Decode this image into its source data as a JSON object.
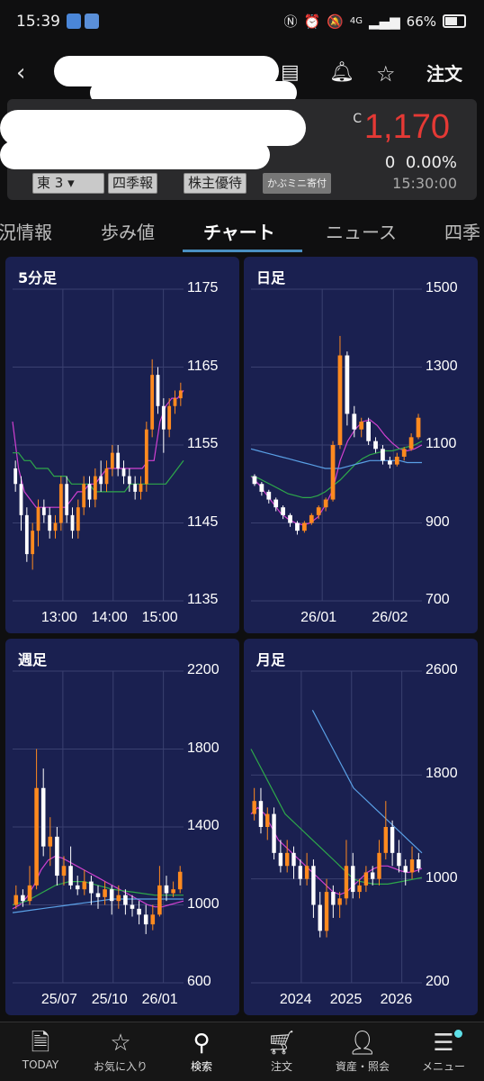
{
  "status_bar": {
    "time": "15:39",
    "battery": "66%",
    "network": "4G"
  },
  "header": {
    "order_label": "注文"
  },
  "quote": {
    "price_mark": "C",
    "price": "1,170",
    "change": "0",
    "change_pct": "0.00%",
    "time": "15:30:00",
    "market": "東 3",
    "chips": [
      "四季報",
      "株主優待",
      "かぶミニ寄付"
    ]
  },
  "tabs": [
    "況情報",
    "歩み値",
    "チャート",
    "ニュース",
    "四季"
  ],
  "active_tab": "チャート",
  "colors": {
    "up": "#ff8a1f",
    "down": "#ffffff",
    "panel_bg": "#1a2050",
    "accent": "#4a90c2",
    "price_red": "#e53935"
  },
  "chart_data": [
    {
      "type": "candlestick",
      "title": "5分足",
      "y_ticks": [
        "1175",
        "1165",
        "1155",
        "1145",
        "1135"
      ],
      "ylim": [
        1135,
        1175
      ],
      "x_ticks": [
        "13:00",
        "14:00",
        "15:00"
      ],
      "series": [
        {
          "color": "#d040d0",
          "values": [
            1158,
            1152,
            1149,
            1148,
            1147,
            1147,
            1147,
            1147,
            1147,
            1147,
            1148,
            1149,
            1149,
            1150,
            1150,
            1151,
            1152,
            1152,
            1152,
            1152,
            1152,
            1152,
            1152,
            1153,
            1153,
            1158,
            1160,
            1161,
            1161,
            1162
          ]
        },
        {
          "color": "#2ea84a",
          "values": [
            1154,
            1154,
            1153,
            1153,
            1152,
            1152,
            1152,
            1151,
            1151,
            1151,
            1150,
            1150,
            1150,
            1150,
            1149,
            1149,
            1149,
            1149,
            1149,
            1149,
            1150,
            1150,
            1150,
            1150,
            1150,
            1150,
            1150,
            1151,
            1152,
            1153
          ]
        }
      ],
      "candles": [
        [
          1152,
          1150,
          1153,
          1149
        ],
        [
          1150,
          1146,
          1151,
          1144
        ],
        [
          1146,
          1141,
          1147,
          1140
        ],
        [
          1141,
          1144,
          1145,
          1139
        ],
        [
          1144,
          1147,
          1148,
          1142
        ],
        [
          1147,
          1146,
          1148,
          1145
        ],
        [
          1146,
          1144,
          1147,
          1143
        ],
        [
          1144,
          1145,
          1146,
          1143
        ],
        [
          1145,
          1150,
          1151,
          1144
        ],
        [
          1150,
          1146,
          1151,
          1145
        ],
        [
          1146,
          1144,
          1147,
          1143
        ],
        [
          1144,
          1147,
          1148,
          1143
        ],
        [
          1147,
          1150,
          1151,
          1146
        ],
        [
          1150,
          1148,
          1151,
          1147
        ],
        [
          1148,
          1151,
          1152,
          1147
        ],
        [
          1151,
          1150,
          1153,
          1149
        ],
        [
          1150,
          1152,
          1153,
          1149
        ],
        [
          1152,
          1154,
          1155,
          1151
        ],
        [
          1154,
          1152,
          1155,
          1151
        ],
        [
          1152,
          1151,
          1153,
          1150
        ],
        [
          1151,
          1150,
          1152,
          1149
        ],
        [
          1150,
          1149,
          1151,
          1148
        ],
        [
          1149,
          1150,
          1151,
          1148
        ],
        [
          1150,
          1157,
          1158,
          1149
        ],
        [
          1157,
          1164,
          1166,
          1156
        ],
        [
          1164,
          1160,
          1165,
          1159
        ],
        [
          1160,
          1157,
          1161,
          1154
        ],
        [
          1157,
          1160,
          1161,
          1156
        ],
        [
          1160,
          1161,
          1162,
          1159
        ],
        [
          1161,
          1162,
          1163,
          1160
        ]
      ]
    },
    {
      "type": "candlestick",
      "title": "日足",
      "y_ticks": [
        "1500",
        "1300",
        "1100",
        "900",
        "700"
      ],
      "ylim": [
        700,
        1500
      ],
      "x_ticks": [
        "26/01",
        "26/02"
      ],
      "series": [
        {
          "color": "#d040d0",
          "values": [
            1020,
            1000,
            975,
            950,
            925,
            910,
            900,
            895,
            900,
            915,
            945,
            985,
            1060,
            1110,
            1140,
            1160,
            1165,
            1150,
            1125,
            1105,
            1090,
            1085,
            1090,
            1100
          ]
        },
        {
          "color": "#2ea84a",
          "values": [
            1020,
            1015,
            1005,
            995,
            985,
            975,
            970,
            965,
            965,
            970,
            980,
            995,
            1010,
            1030,
            1050,
            1065,
            1075,
            1080,
            1085,
            1085,
            1090,
            1095,
            1100,
            1110
          ]
        },
        {
          "color": "#5aa0e6",
          "values": [
            1090,
            1085,
            1080,
            1075,
            1070,
            1065,
            1060,
            1055,
            1050,
            1045,
            1040,
            1040,
            1040,
            1045,
            1050,
            1055,
            1060,
            1060,
            1060,
            1060,
            1060,
            1055,
            1055,
            1055
          ]
        }
      ],
      "candles": [
        [
          1020,
          1000,
          1025,
          995
        ],
        [
          1000,
          980,
          1005,
          970
        ],
        [
          980,
          960,
          985,
          950
        ],
        [
          960,
          940,
          965,
          930
        ],
        [
          940,
          920,
          945,
          910
        ],
        [
          920,
          900,
          925,
          890
        ],
        [
          900,
          880,
          905,
          870
        ],
        [
          880,
          900,
          905,
          875
        ],
        [
          900,
          920,
          925,
          895
        ],
        [
          920,
          940,
          945,
          910
        ],
        [
          940,
          960,
          965,
          930
        ],
        [
          960,
          1100,
          1110,
          955
        ],
        [
          1100,
          1330,
          1380,
          1090
        ],
        [
          1330,
          1180,
          1340,
          1150
        ],
        [
          1180,
          1140,
          1200,
          1120
        ],
        [
          1140,
          1160,
          1170,
          1120
        ],
        [
          1160,
          1110,
          1170,
          1100
        ],
        [
          1110,
          1090,
          1120,
          1080
        ],
        [
          1090,
          1060,
          1100,
          1050
        ],
        [
          1060,
          1050,
          1070,
          1040
        ],
        [
          1050,
          1070,
          1080,
          1045
        ],
        [
          1070,
          1090,
          1095,
          1060
        ],
        [
          1090,
          1120,
          1130,
          1085
        ],
        [
          1120,
          1170,
          1180,
          1115
        ]
      ]
    },
    {
      "type": "candlestick",
      "title": "週足",
      "y_ticks": [
        "2200",
        "1800",
        "1400",
        "1000",
        "600"
      ],
      "ylim": [
        600,
        2200
      ],
      "x_ticks": [
        "25/07",
        "25/10",
        "26/01"
      ],
      "series": [
        {
          "color": "#d040d0",
          "values": [
            980,
            1000,
            1040,
            1100,
            1180,
            1230,
            1250,
            1240,
            1220,
            1200,
            1180,
            1160,
            1140,
            1120,
            1100,
            1080,
            1060,
            1040,
            1020,
            1000,
            990,
            990,
            1000,
            1010,
            1020
          ]
        },
        {
          "color": "#2ea84a",
          "values": [
            1000,
            1010,
            1020,
            1040,
            1060,
            1080,
            1100,
            1110,
            1120,
            1120,
            1120,
            1110,
            1100,
            1090,
            1080,
            1075,
            1070,
            1065,
            1060,
            1055,
            1050,
            1050,
            1050,
            1050,
            1050
          ]
        },
        {
          "color": "#5aa0e6",
          "values": [
            960,
            965,
            970,
            975,
            980,
            985,
            990,
            995,
            1000,
            1005,
            1010,
            1015,
            1020,
            1025,
            1030,
            1030,
            1030,
            1030,
            1030,
            1030,
            1030,
            1030,
            1030,
            1030,
            1030
          ]
        }
      ],
      "candles": [
        [
          1000,
          1050,
          1100,
          980
        ],
        [
          1050,
          1020,
          1080,
          990
        ],
        [
          1020,
          1100,
          1200,
          1000
        ],
        [
          1100,
          1600,
          1800,
          1080
        ],
        [
          1600,
          1300,
          1700,
          1250
        ],
        [
          1300,
          1350,
          1450,
          1200
        ],
        [
          1350,
          1150,
          1400,
          1100
        ],
        [
          1150,
          1200,
          1250,
          1100
        ],
        [
          1200,
          1100,
          1300,
          1080
        ],
        [
          1100,
          1080,
          1150,
          1050
        ],
        [
          1080,
          1120,
          1180,
          1050
        ],
        [
          1120,
          1060,
          1150,
          1000
        ],
        [
          1060,
          1040,
          1100,
          980
        ],
        [
          1040,
          1080,
          1120,
          1000
        ],
        [
          1080,
          1020,
          1100,
          950
        ],
        [
          1020,
          1050,
          1100,
          980
        ],
        [
          1050,
          1000,
          1080,
          950
        ],
        [
          1000,
          980,
          1050,
          940
        ],
        [
          980,
          950,
          1020,
          900
        ],
        [
          950,
          900,
          1000,
          850
        ],
        [
          900,
          950,
          1000,
          870
        ],
        [
          950,
          1100,
          1200,
          940
        ],
        [
          1100,
          1060,
          1150,
          1020
        ],
        [
          1060,
          1080,
          1120,
          1040
        ],
        [
          1080,
          1170,
          1200,
          1060
        ]
      ]
    },
    {
      "type": "candlestick",
      "title": "月足",
      "y_ticks": [
        "2600",
        "1800",
        "1000",
        "200"
      ],
      "ylim": [
        200,
        2600
      ],
      "x_ticks": [
        "2024",
        "2025",
        "2026"
      ],
      "series": [
        {
          "color": "#d040d0",
          "values": [
            1500,
            1550,
            1500,
            1400,
            1300,
            1250,
            1200,
            1150,
            1100,
            1050,
            1000,
            950,
            900,
            880,
            900,
            950,
            1000,
            1050,
            1080,
            1100,
            1100,
            1080,
            1060,
            1050,
            1060,
            1080
          ]
        },
        {
          "color": "#2ea84a",
          "values": [
            2000,
            1900,
            1800,
            1700,
            1600,
            1500,
            1450,
            1400,
            1350,
            1300,
            1250,
            1200,
            1150,
            1100,
            1050,
            1000,
            980,
            970,
            960,
            960,
            960,
            970,
            980,
            990,
            1000,
            1010
          ]
        },
        {
          "color": "#5aa0e6",
          "values": [
            null,
            null,
            null,
            null,
            null,
            null,
            null,
            null,
            null,
            2300,
            2200,
            2100,
            2000,
            1900,
            1800,
            1700,
            1650,
            1600,
            1550,
            1500,
            1450,
            1400,
            1350,
            1300,
            1250,
            1200
          ]
        }
      ],
      "candles": [
        [
          1500,
          1600,
          1700,
          1450
        ],
        [
          1600,
          1400,
          1700,
          1350
        ],
        [
          1400,
          1500,
          1550,
          1300
        ],
        [
          1500,
          1200,
          1550,
          1150
        ],
        [
          1200,
          1100,
          1300,
          1050
        ],
        [
          1100,
          1200,
          1300,
          1050
        ],
        [
          1200,
          1100,
          1250,
          1000
        ],
        [
          1100,
          1000,
          1150,
          950
        ],
        [
          1000,
          1100,
          1200,
          950
        ],
        [
          1100,
          800,
          1150,
          700
        ],
        [
          800,
          600,
          900,
          550
        ],
        [
          600,
          900,
          1000,
          550
        ],
        [
          900,
          800,
          950,
          700
        ],
        [
          800,
          850,
          900,
          700
        ],
        [
          850,
          1100,
          1300,
          800
        ],
        [
          1100,
          900,
          1200,
          850
        ],
        [
          900,
          950,
          1000,
          850
        ],
        [
          950,
          1050,
          1100,
          900
        ],
        [
          1050,
          1000,
          1100,
          950
        ],
        [
          1000,
          1200,
          1300,
          950
        ],
        [
          1200,
          1400,
          1600,
          1150
        ],
        [
          1400,
          1200,
          1450,
          1100
        ],
        [
          1200,
          1100,
          1300,
          1050
        ],
        [
          1100,
          1050,
          1150,
          950
        ],
        [
          1050,
          1150,
          1250,
          1000
        ],
        [
          1150,
          1080,
          1200,
          1050
        ]
      ]
    }
  ],
  "bottom_nav": [
    {
      "label": "TODAY",
      "icon": "doc-icon"
    },
    {
      "label": "お気に入り",
      "icon": "star-icon"
    },
    {
      "label": "検索",
      "icon": "search-icon"
    },
    {
      "label": "注文",
      "icon": "cart-icon"
    },
    {
      "label": "資産・照会",
      "icon": "person-icon"
    },
    {
      "label": "メニュー",
      "icon": "menu-icon"
    }
  ]
}
